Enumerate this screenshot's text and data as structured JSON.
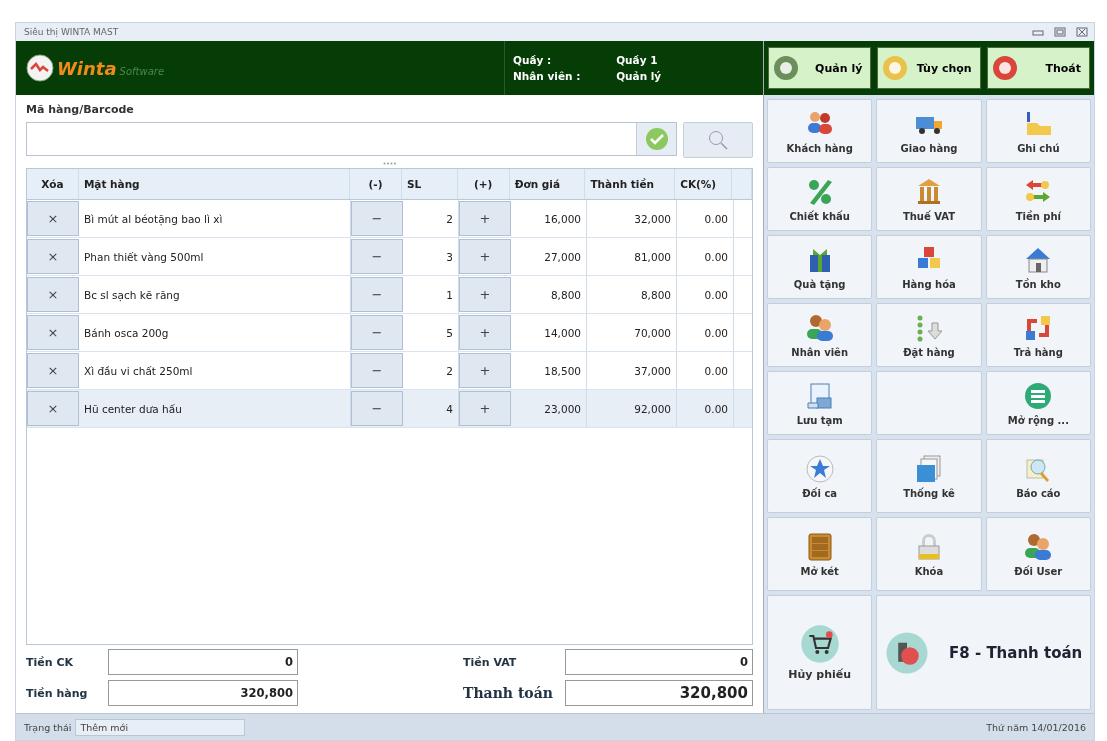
{
  "window": {
    "title": "Siêu thị WINTA MAST"
  },
  "header": {
    "logo_main": "Winta",
    "logo_sub": "Software",
    "counter_label": "Quầy :",
    "counter_value": "Quầy 1",
    "staff_label": "Nhân viên :",
    "staff_value": "Quản lý"
  },
  "top_buttons": [
    {
      "label": "Quản lý",
      "color": "#6b8e5a"
    },
    {
      "label": "Tùy chọn",
      "color": "#e8c24a"
    },
    {
      "label": "Thoát",
      "color": "#d9463a"
    }
  ],
  "barcode": {
    "label": "Mã hàng/Barcode"
  },
  "table": {
    "columns": [
      "Xóa",
      "Mặt hàng",
      "(-)",
      "SL",
      "(+)",
      "Đơn giá",
      "Thành tiền",
      "CK(%)"
    ],
    "rows": [
      {
        "delete": "×",
        "name": "Bì mút al béotặng bao lì xì",
        "minus": "−",
        "qty": "2",
        "plus": "+",
        "price": "16,000",
        "total": "32,000",
        "discount": "0.00",
        "selected": false
      },
      {
        "delete": "×",
        "name": "Phan thiết vàng 500ml",
        "minus": "−",
        "qty": "3",
        "plus": "+",
        "price": "27,000",
        "total": "81,000",
        "discount": "0.00",
        "selected": false
      },
      {
        "delete": "×",
        "name": "Bc sl sạch kẽ răng",
        "minus": "−",
        "qty": "1",
        "plus": "+",
        "price": "8,800",
        "total": "8,800",
        "discount": "0.00",
        "selected": false
      },
      {
        "delete": "×",
        "name": "Bánh osca 200g",
        "minus": "−",
        "qty": "5",
        "plus": "+",
        "price": "14,000",
        "total": "70,000",
        "discount": "0.00",
        "selected": false
      },
      {
        "delete": "×",
        "name": "Xì đầu vi chất 250ml",
        "minus": "−",
        "qty": "2",
        "plus": "+",
        "price": "18,500",
        "total": "37,000",
        "discount": "0.00",
        "selected": false
      },
      {
        "delete": "×",
        "name": "Hũ center dưa hấu",
        "minus": "−",
        "qty": "4",
        "plus": "+",
        "price": "23,000",
        "total": "92,000",
        "discount": "0.00",
        "selected": true
      }
    ]
  },
  "totals": {
    "discount_label": "Tiền CK",
    "discount": "0",
    "vat_label": "Tiền VAT",
    "vat": "0",
    "goods_label": "Tiền hàng",
    "goods": "320,800",
    "pay_label": "Thanh toán",
    "pay": "320,800"
  },
  "actions": [
    {
      "kind": "tool",
      "label": "Khách hàng"
    },
    {
      "kind": "tool",
      "label": "Giao hàng"
    },
    {
      "kind": "tool",
      "label": "Ghi chú"
    },
    {
      "kind": "tool",
      "label": "Chiết khấu"
    },
    {
      "kind": "tool",
      "label": "Thuế VAT"
    },
    {
      "kind": "tool",
      "label": "Tiền phí"
    },
    {
      "kind": "tool",
      "label": "Quà tặng"
    },
    {
      "kind": "tool",
      "label": "Hàng hóa"
    },
    {
      "kind": "tool",
      "label": "Tồn kho"
    },
    {
      "kind": "tool",
      "label": "Nhân viên"
    },
    {
      "kind": "tool",
      "label": "Đặt hàng"
    },
    {
      "kind": "tool",
      "label": "Trả hàng"
    },
    {
      "kind": "tool",
      "label": "Lưu tạm"
    },
    {
      "kind": "blank"
    },
    {
      "kind": "tool",
      "label": "Mở rộng ..."
    },
    {
      "kind": "tool",
      "label": "Đối ca"
    },
    {
      "kind": "tool",
      "label": "Thống kê"
    },
    {
      "kind": "tool",
      "label": "Báo cáo"
    },
    {
      "kind": "tool",
      "label": "Mở két"
    },
    {
      "kind": "tool",
      "label": "Khóa"
    },
    {
      "kind": "tool",
      "label": "Đối User"
    },
    {
      "kind": "cancel",
      "label": "Hủy phiếu"
    },
    {
      "kind": "pay",
      "label": "F8 - Thanh toán"
    }
  ],
  "status_bar": {
    "label": "Trạng thái",
    "value": "Thêm mới",
    "date": "Thứ năm 14/01/2016"
  }
}
